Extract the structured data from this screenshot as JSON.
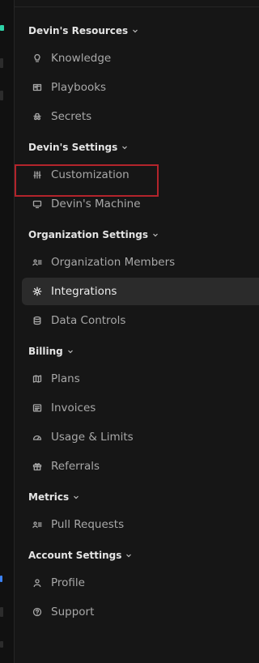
{
  "sections": {
    "resources": {
      "label": "Devin's Resources",
      "items": [
        {
          "label": "Knowledge",
          "icon": "lightbulb-icon"
        },
        {
          "label": "Playbooks",
          "icon": "book-open-icon"
        },
        {
          "label": "Secrets",
          "icon": "incognito-icon"
        }
      ]
    },
    "settings": {
      "label": "Devin's Settings",
      "items": [
        {
          "label": "Customization",
          "icon": "sliders-icon"
        },
        {
          "label": "Devin's Machine",
          "icon": "monitor-icon"
        }
      ]
    },
    "org": {
      "label": "Organization Settings",
      "items": [
        {
          "label": "Organization Members",
          "icon": "members-icon"
        },
        {
          "label": "Integrations",
          "icon": "gear-icon"
        },
        {
          "label": "Data Controls",
          "icon": "database-icon"
        }
      ]
    },
    "billing": {
      "label": "Billing",
      "items": [
        {
          "label": "Plans",
          "icon": "map-icon"
        },
        {
          "label": "Invoices",
          "icon": "invoice-icon"
        },
        {
          "label": "Usage & Limits",
          "icon": "gauge-icon"
        },
        {
          "label": "Referrals",
          "icon": "gift-icon"
        }
      ]
    },
    "metrics": {
      "label": "Metrics",
      "items": [
        {
          "label": "Pull Requests",
          "icon": "members-icon"
        }
      ]
    },
    "account": {
      "label": "Account Settings",
      "items": [
        {
          "label": "Profile",
          "icon": "user-icon"
        },
        {
          "label": "Support",
          "icon": "help-circle-icon"
        }
      ]
    }
  },
  "active_item": "Integrations",
  "highlighted_item": "Devin's Machine",
  "colors": {
    "background": "#161616",
    "active_bg": "#2b2b2b",
    "highlight_border": "#b3242b",
    "brand": "#2ed3a8"
  }
}
